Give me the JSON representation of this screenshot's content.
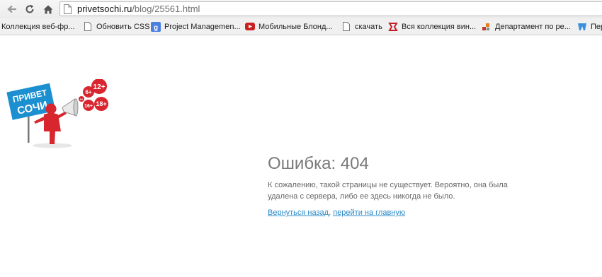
{
  "browser": {
    "url_host": "privetsochi.ru",
    "url_path": "/blog/25561.html"
  },
  "bookmarks": [
    {
      "label": "Коллекция веб-фр...",
      "icon": "folder-icon"
    },
    {
      "label": "Обновить CSS",
      "icon": "page-icon"
    },
    {
      "label": "Project Managemen...",
      "icon": "google-icon"
    },
    {
      "label": "Мобильные Блонд...",
      "icon": "youtube-icon"
    },
    {
      "label": "скачать",
      "icon": "page-icon"
    },
    {
      "label": "Вся коллекция вин...",
      "icon": "red-logo-icon"
    },
    {
      "label": "Департамент по ре...",
      "icon": "gear-colorful-icon"
    },
    {
      "label": "Пер",
      "icon": "blue-logo-icon"
    }
  ],
  "logo": {
    "sign_text_1": "ПРИВЕТ",
    "sign_text_2": "СОЧИ",
    "age_badges": [
      "12+",
      "6+",
      "16+",
      "18+",
      "0+"
    ]
  },
  "error": {
    "title": "Ошибка: 404",
    "message": "К сожалению, такой страницы не существует. Вероятно, она была удалена с сервера, либо ее здесь никогда не было.",
    "link_back": "Вернуться назад",
    "separator": ", ",
    "link_home": "перейти на главную"
  },
  "colors": {
    "link": "#2a8bc8",
    "title": "#7a7a7a",
    "logo_blue": "#1b8fd0",
    "logo_red": "#d8262e"
  }
}
